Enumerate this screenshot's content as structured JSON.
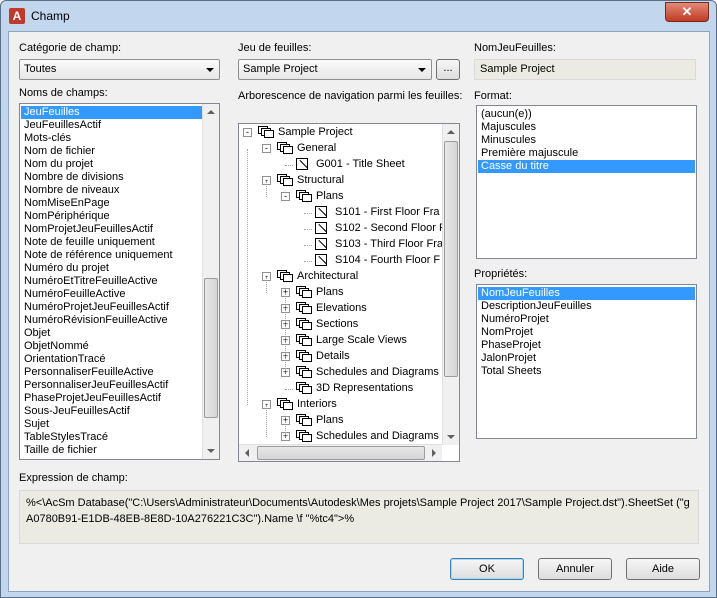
{
  "window": {
    "title": "Champ",
    "close_glyph": "✕",
    "app_icon_letter": "A"
  },
  "category": {
    "label": "Catégorie de champ:",
    "value": "Toutes"
  },
  "field_names": {
    "label": "Noms de champs:",
    "items": [
      "JeuFeuilles",
      "JeuFeuillesActif",
      "Mots-clés",
      "Nom de fichier",
      "Nom du projet",
      "Nombre de divisions",
      "Nombre de niveaux",
      "NomMiseEnPage",
      "NomPériphérique",
      "NomProjetJeuFeuillesActif",
      "Note de feuille uniquement",
      "Note de référence uniquement",
      "Numéro du projet",
      "NuméroEtTitreFeuilleActive",
      "NuméroFeuilleActive",
      "NuméroProjetJeuFeuillesActif",
      "NuméroRévisionFeuilleActive",
      "Objet",
      "ObjetNommé",
      "OrientationTracé",
      "PersonnaliserFeuilleActive",
      "PersonnaliserJeuFeuillesActif",
      "PhaseProjetJeuFeuillesActif",
      "Sous-JeuFeuillesActif",
      "Sujet",
      "TableStylesTracé",
      "Taille de fichier"
    ],
    "selected_index": 0
  },
  "sheet_set": {
    "label": "Jeu de feuilles:",
    "value": "Sample Project",
    "browse_label": "..."
  },
  "tree": {
    "label": "Arborescence de navigation parmi les feuilles:",
    "nodes": [
      {
        "text": "Sample Project",
        "level": 0,
        "kind": "set",
        "exp": "-"
      },
      {
        "text": "General",
        "level": 1,
        "kind": "set",
        "exp": "-"
      },
      {
        "text": "G001 - Title Sheet",
        "level": 2,
        "kind": "sheet",
        "exp": ""
      },
      {
        "text": "Structural",
        "level": 1,
        "kind": "set",
        "exp": "-"
      },
      {
        "text": "Plans",
        "level": 2,
        "kind": "set",
        "exp": "-"
      },
      {
        "text": "S101 - First Floor Fra",
        "level": 3,
        "kind": "sheet",
        "exp": ""
      },
      {
        "text": "S102 - Second Floor F",
        "level": 3,
        "kind": "sheet",
        "exp": ""
      },
      {
        "text": "S103 - Third Floor Fra",
        "level": 3,
        "kind": "sheet",
        "exp": ""
      },
      {
        "text": "S104 - Fourth Floor F",
        "level": 3,
        "kind": "sheet",
        "exp": ""
      },
      {
        "text": "Architectural",
        "level": 1,
        "kind": "set",
        "exp": "-"
      },
      {
        "text": "Plans",
        "level": 2,
        "kind": "set",
        "exp": "+"
      },
      {
        "text": "Elevations",
        "level": 2,
        "kind": "set",
        "exp": "+"
      },
      {
        "text": "Sections",
        "level": 2,
        "kind": "set",
        "exp": "+"
      },
      {
        "text": "Large Scale Views",
        "level": 2,
        "kind": "set",
        "exp": "+"
      },
      {
        "text": "Details",
        "level": 2,
        "kind": "set",
        "exp": "+"
      },
      {
        "text": "Schedules and Diagrams",
        "level": 2,
        "kind": "set",
        "exp": "+"
      },
      {
        "text": "3D Representations",
        "level": 2,
        "kind": "set",
        "exp": ""
      },
      {
        "text": "Interiors",
        "level": 1,
        "kind": "set",
        "exp": "-"
      },
      {
        "text": "Plans",
        "level": 2,
        "kind": "set",
        "exp": "+"
      },
      {
        "text": "Schedules and Diagrams",
        "level": 2,
        "kind": "set",
        "exp": "+"
      }
    ]
  },
  "nom_jeu": {
    "label": "NomJeuFeuilles:",
    "value": "Sample Project"
  },
  "format": {
    "label": "Format:",
    "items": [
      "(aucun(e))",
      "Majuscules",
      "Minuscules",
      "Première majuscule",
      "Casse du titre"
    ],
    "selected_index": 4
  },
  "properties": {
    "label": "Propriétés:",
    "items": [
      "NomJeuFeuilles",
      "DescriptionJeuFeuilles",
      "NuméroProjet",
      "NomProjet",
      "PhaseProjet",
      "JalonProjet",
      "Total Sheets"
    ],
    "selected_index": 0
  },
  "expression": {
    "label": "Expression de champ:",
    "value": "%<\\AcSm Database(\"C:\\Users\\Administrateur\\Documents\\Autodesk\\Mes projets\\Sample Project 2017\\Sample Project.dst\").SheetSet (\"gA0780B91-E1DB-48EB-8E8D-10A276221C3C\").Name \\f \"%tc4\">%"
  },
  "buttons": {
    "ok": "OK",
    "cancel": "Annuler",
    "help": "Aide"
  },
  "colors": {
    "selection": "#3399ff",
    "frame": "#c2d6ee",
    "close": "#c23b22"
  }
}
